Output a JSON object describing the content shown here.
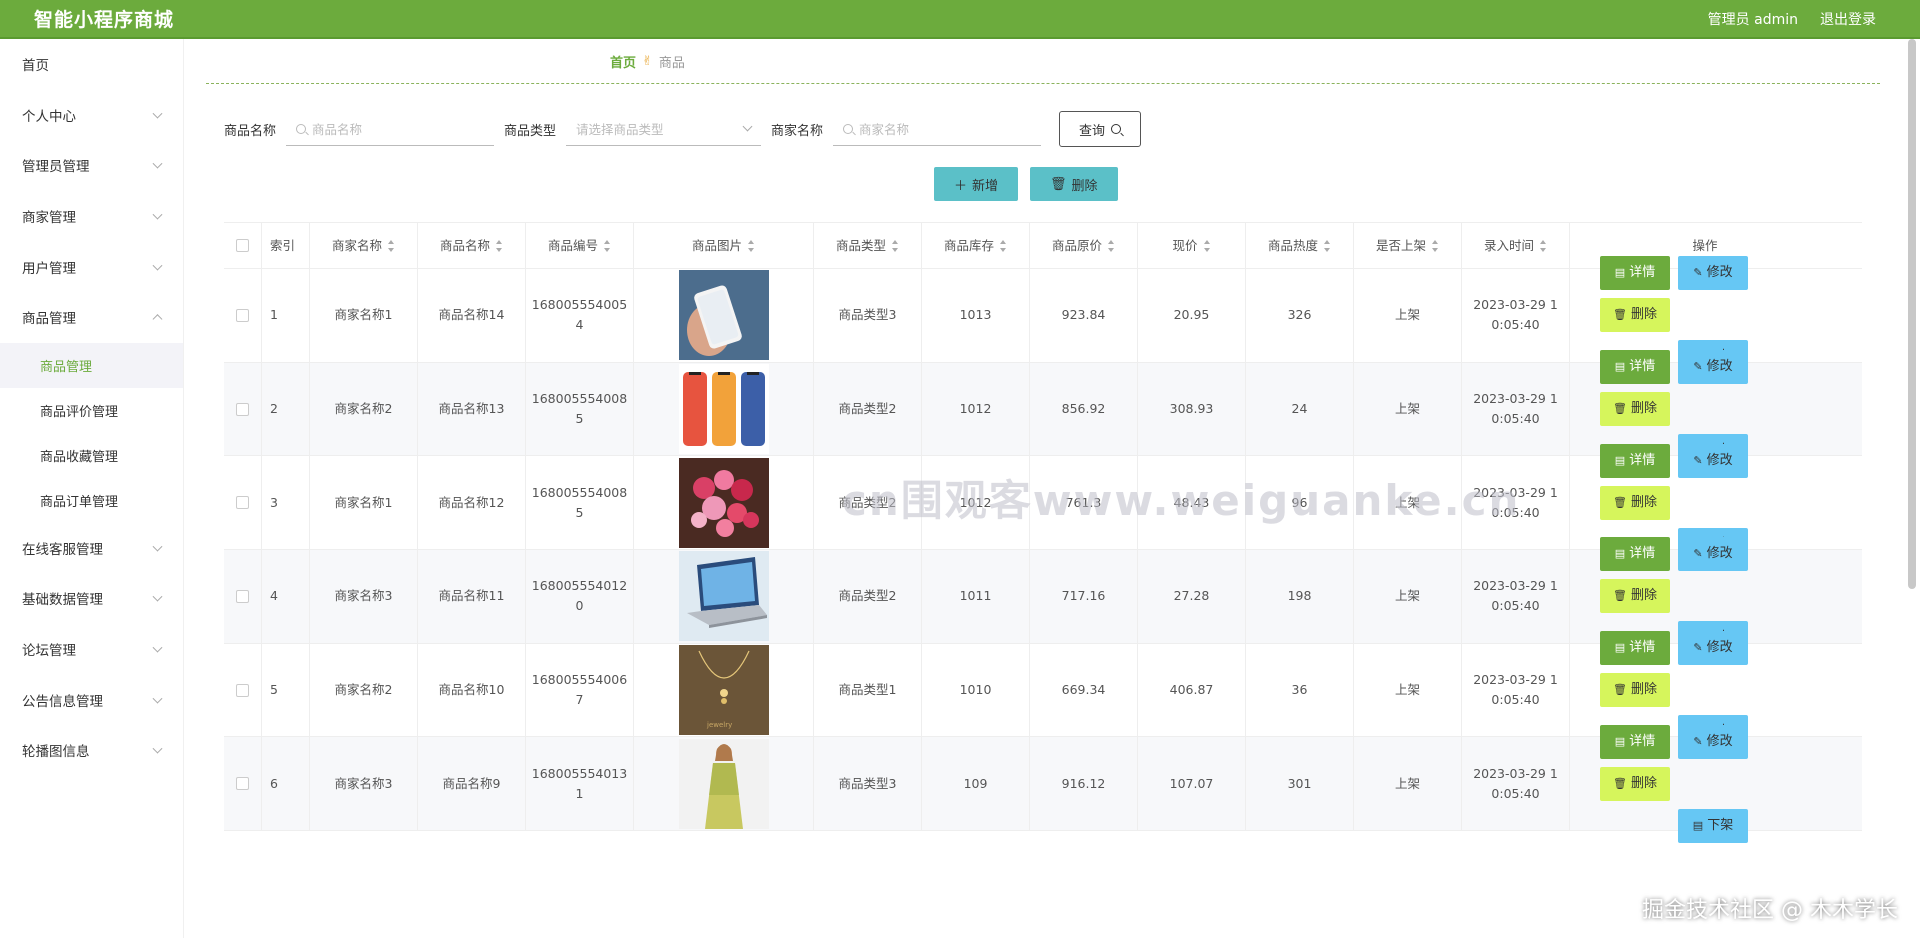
{
  "header": {
    "title": "智能小程序商城",
    "user": "管理员 admin",
    "logout": "退出登录"
  },
  "sidebar": {
    "items": [
      {
        "label": "首页"
      },
      {
        "label": "个人中心"
      },
      {
        "label": "管理员管理"
      },
      {
        "label": "商家管理"
      },
      {
        "label": "用户管理"
      },
      {
        "label": "商品管理"
      }
    ],
    "sub_items": [
      {
        "label": "商品管理"
      },
      {
        "label": "商品评价管理"
      },
      {
        "label": "商品收藏管理"
      },
      {
        "label": "商品订单管理"
      }
    ],
    "items_after": [
      {
        "label": "在线客服管理"
      },
      {
        "label": "基础数据管理"
      },
      {
        "label": "论坛管理"
      },
      {
        "label": "公告信息管理"
      },
      {
        "label": "轮播图信息"
      }
    ]
  },
  "breadcrumb": {
    "home": "首页",
    "current": "商品"
  },
  "search": {
    "name_label": "商品名称",
    "name_placeholder": "商品名称",
    "type_label": "商品类型",
    "type_placeholder": "请选择商品类型",
    "shop_label": "商家名称",
    "shop_placeholder": "商家名称",
    "query": "查询"
  },
  "actions": {
    "add": "新增",
    "delete": "删除"
  },
  "table": {
    "columns": [
      "索引",
      "商家名称",
      "商品名称",
      "商品编号",
      "商品图片",
      "商品类型",
      "商品库存",
      "商品原价",
      "现价",
      "商品热度",
      "是否上架",
      "录入时间",
      "操作"
    ],
    "ops": {
      "detail": "详情",
      "edit": "修改",
      "del": "删除",
      "down": "下架"
    },
    "rows": [
      {
        "idx": "1",
        "shop": "商家名称1",
        "name": "商品名称14",
        "code": "1680055540054",
        "type": "商品类型3",
        "stock": "1013",
        "price": "923.84",
        "now": "20.95",
        "hot": "326",
        "on": "上架",
        "time": "2023-03-29 10:05:40",
        "img": "phone-hand"
      },
      {
        "idx": "2",
        "shop": "商家名称2",
        "name": "商品名称13",
        "code": "1680055540085",
        "type": "商品类型2",
        "stock": "1012",
        "price": "856.92",
        "now": "308.93",
        "hot": "24",
        "on": "上架",
        "time": "2023-03-29 10:05:40",
        "img": "phones"
      },
      {
        "idx": "3",
        "shop": "商家名称1",
        "name": "商品名称12",
        "code": "1680055540085",
        "type": "商品类型2",
        "stock": "1012",
        "price": "761.3",
        "now": "48.43",
        "hot": "96",
        "on": "上架",
        "time": "2023-03-29 10:05:40",
        "img": "flowers"
      },
      {
        "idx": "4",
        "shop": "商家名称3",
        "name": "商品名称11",
        "code": "1680055540120",
        "type": "商品类型2",
        "stock": "1011",
        "price": "717.16",
        "now": "27.28",
        "hot": "198",
        "on": "上架",
        "time": "2023-03-29 10:05:40",
        "img": "laptop"
      },
      {
        "idx": "5",
        "shop": "商家名称2",
        "name": "商品名称10",
        "code": "1680055540067",
        "type": "商品类型1",
        "stock": "1010",
        "price": "669.34",
        "now": "406.87",
        "hot": "36",
        "on": "上架",
        "time": "2023-03-29 10:05:40",
        "img": "necklace"
      },
      {
        "idx": "6",
        "shop": "商家名称3",
        "name": "商品名称9",
        "code": "1680055540131",
        "type": "商品类型3",
        "stock": "109",
        "price": "916.12",
        "now": "107.07",
        "hot": "301",
        "on": "上架",
        "time": "2023-03-29 10:05:40",
        "img": "dress"
      }
    ]
  },
  "watermark": "cn围观客www.weiguanke.cn",
  "watermark2": "掘金技术社区 @ 木木学长"
}
